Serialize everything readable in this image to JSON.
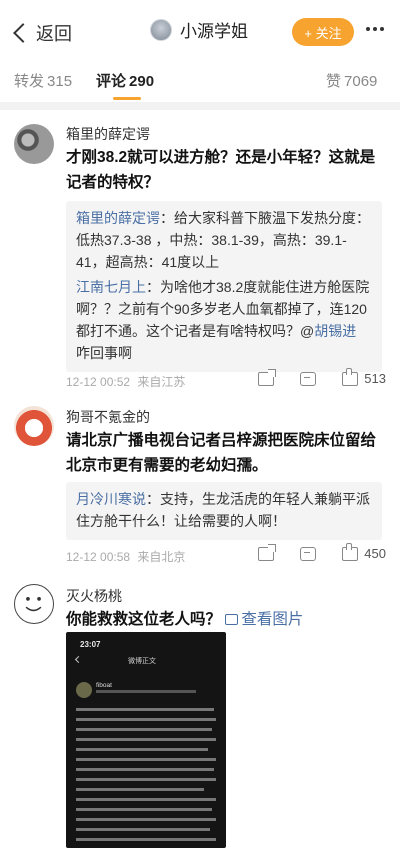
{
  "header": {
    "back_label": "返回",
    "title": "小源学姐",
    "follow_label": "+ 关注"
  },
  "tabs": [
    {
      "label": "转发",
      "count": "315"
    },
    {
      "label": "评论",
      "count": "290"
    },
    {
      "label": "赞",
      "count": "7069"
    }
  ],
  "comments": [
    {
      "author": "箱里的薛定谔",
      "text": "才刚38.2就可以进方舱？还是小年轻？这就是记者的特权？",
      "replies": [
        {
          "name": "箱里的薛定谔",
          "text": "：给大家科普下腋温下发热分度：低热37.3-38 ，中热：38.1-39，高热：39.1-41，超高热：41度以上"
        },
        {
          "name": "江南七月上",
          "text": "：为啥他才38.2度就能住进方舱医院啊？？之前有个90多岁老人血氧都掉了，连120都打不通。这个记者是有啥特权吗？@",
          "mention": "胡锡进",
          "tail": " 咋回事啊"
        }
      ],
      "time": "12-12 00:52",
      "source": "来自江苏",
      "likes": "513"
    },
    {
      "author": "狗哥不氪金的",
      "text": "请北京广播电视台记者吕梓源把医院床位留给北京市更有需要的老幼妇孺。",
      "replies": [
        {
          "name": "月冷川寒说",
          "text": "：支持，生龙活虎的年轻人兼躺平派住方舱干什么！让给需要的人啊！"
        }
      ],
      "time": "12-12 00:58",
      "source": "来自北京",
      "likes": "450"
    },
    {
      "author": "灭火杨桃",
      "text": "你能救救这位老人吗？",
      "pic_link": "查看图片",
      "image": {
        "time": "23:07",
        "title": "微博正文",
        "user": "fiboat"
      }
    }
  ],
  "colors": {
    "accent": "#f7a330",
    "link": "#4a6fa5"
  }
}
